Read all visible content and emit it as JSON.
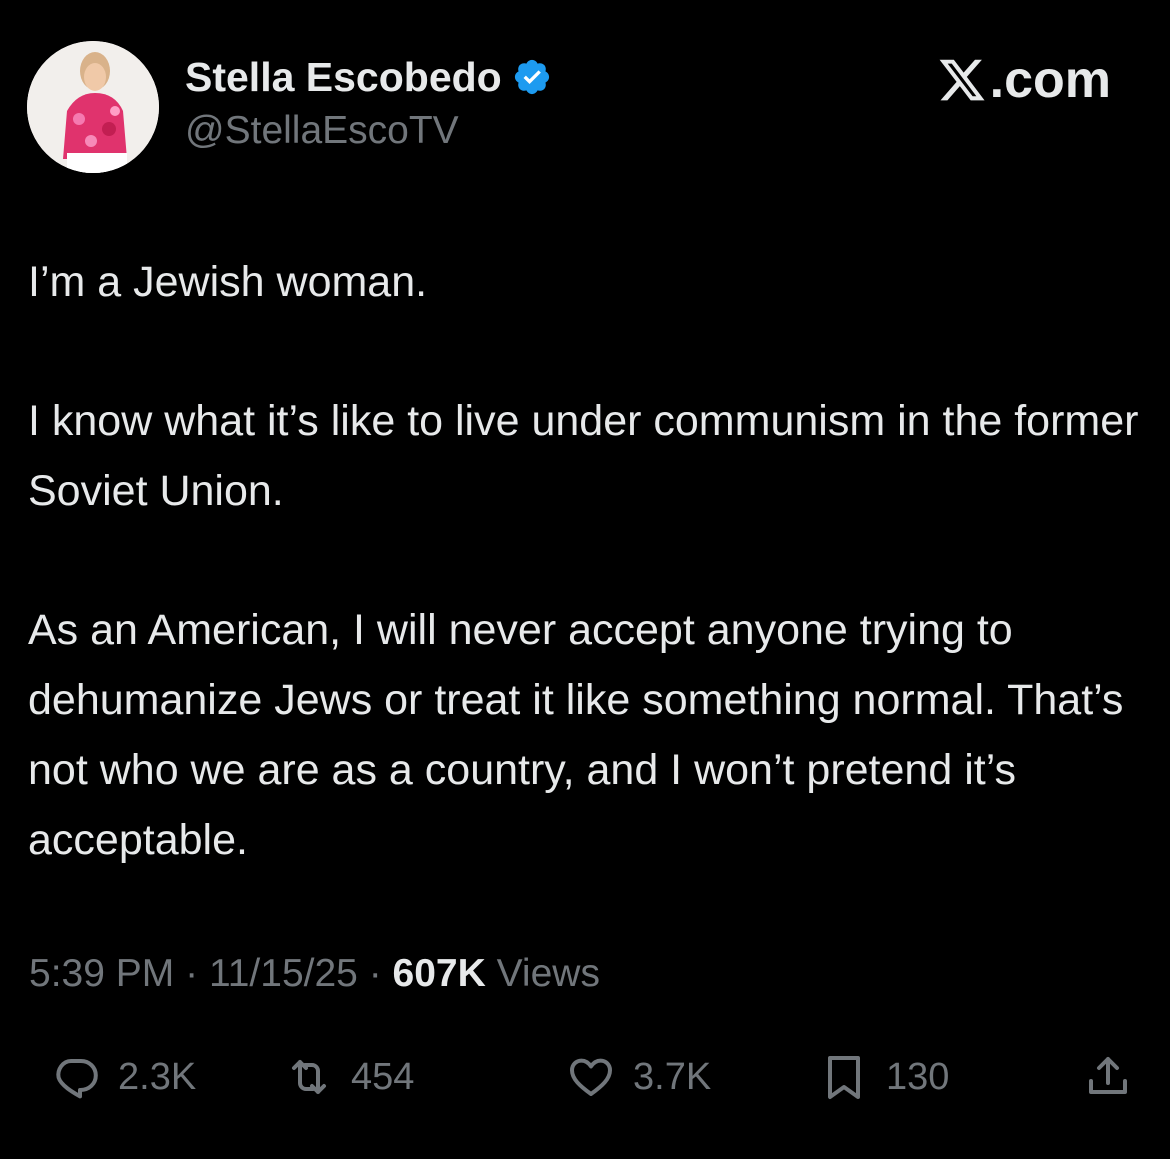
{
  "author": {
    "display_name": "Stella Escobedo",
    "handle": "@StellaEscoTV",
    "verified": true,
    "verified_icon": "verified-badge-icon"
  },
  "brand": {
    "label": ".com",
    "icon": "x-logo-icon"
  },
  "tweet": {
    "paragraphs": [
      "I’m a Jewish woman.",
      "I know what it’s like to live under communism in the former Soviet Union.",
      "As an American, I will never accept anyone trying to dehumanize Jews or treat it like something normal. That’s not who we are as a country, and I won’t pretend it’s acceptable."
    ]
  },
  "meta": {
    "time": "5:39 PM",
    "separator": "·",
    "date": "11/15/25",
    "views_count": "607K",
    "views_label": "Views"
  },
  "actions": {
    "reply_count": "2.3K",
    "repost_count": "454",
    "like_count": "3.7K",
    "bookmark_count": "130"
  },
  "colors": {
    "background": "#000000",
    "text_primary": "#e7e9ea",
    "text_secondary": "#71767b",
    "verified_blue": "#1d9bf0"
  }
}
